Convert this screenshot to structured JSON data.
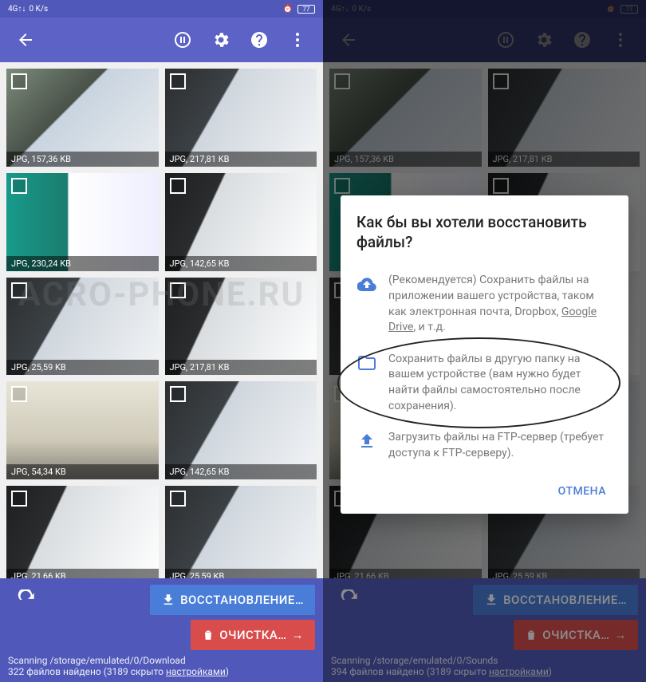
{
  "status": {
    "net": "4G↑↓",
    "speed": "0 K/s",
    "battery": "77"
  },
  "left": {
    "thumbs": [
      {
        "label": "JPG, 157,36 KB",
        "v": 1
      },
      {
        "label": "JPG, 217,81 KB",
        "v": 3
      },
      {
        "label": "JPG, 230,24 KB",
        "v": 2
      },
      {
        "label": "JPG, 142,65 KB",
        "v": 4
      },
      {
        "label": "JPG, 25,59 KB",
        "v": 3
      },
      {
        "label": "JPG, 217,81 KB",
        "v": 4
      },
      {
        "label": "JPG, 54,34 KB",
        "v": 5
      },
      {
        "label": "JPG, 142,65 KB",
        "v": 3
      },
      {
        "label": "JPG, 21,66 KB",
        "v": 4
      },
      {
        "label": "JPG, 25,59 KB",
        "v": 3
      }
    ],
    "restore": "ВОССТАНОВЛЕНИЕ…",
    "cleanup": "ОЧИСТКА…",
    "scan_path": "Scanning /storage/emulated/0/Download",
    "found": "322 файлов найдено (3189 скрыто ",
    "settings_word": "настройками",
    "close_paren": ")"
  },
  "right": {
    "thumbs": [
      {
        "label": "JPG, 157,36 KB",
        "v": 1
      },
      {
        "label": "JPG, 217,81 KB",
        "v": 3
      },
      {
        "label": "",
        "v": 2
      },
      {
        "label": "",
        "v": 4
      },
      {
        "label": "",
        "v": 3
      },
      {
        "label": "",
        "v": 4
      },
      {
        "label": "",
        "v": 5
      },
      {
        "label": "",
        "v": 3
      },
      {
        "label": "JPG, 21,66 KB",
        "v": 4
      },
      {
        "label": "JPG, 25,59 KB",
        "v": 3
      }
    ],
    "restore": "ВОССТАНОВЛЕНИЕ…",
    "cleanup": "ОЧИСТКА…",
    "scan_path": "Scanning /storage/emulated/0/Sounds",
    "found": "394 файлов найдено (3189 скрыто ",
    "settings_word": "настройками",
    "close_paren": ")"
  },
  "dialog": {
    "title": "Как бы вы хотели восстановить файлы?",
    "opt1": "(Рекомендуется) Сохранить файлы на приложении вашего устройства, таком как электронная почта, Dropbox, ",
    "opt1_link": "Google Drive",
    "opt1_tail": ", и т.д.",
    "opt2": "Сохранить файлы в другую папку на вашем устройстве (вам нужно будет найти файлы самостоятельно после сохранения).",
    "opt3": "Загрузить файлы на FTP-сервер (требует доступа к FTP-серверу).",
    "cancel": "ОТМЕНА"
  },
  "watermark": "ACRO-PHONE.RU"
}
